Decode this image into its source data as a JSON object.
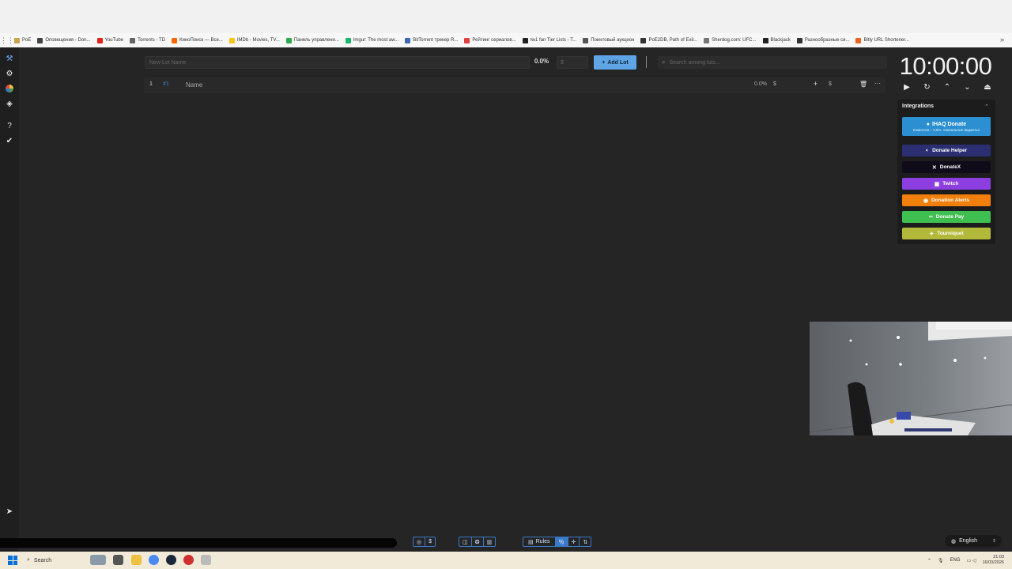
{
  "bookmarks": [
    {
      "label": "PoE",
      "color": "#caa44a"
    },
    {
      "label": "Оповещения - Don...",
      "color": "#444444"
    },
    {
      "label": "YouTube",
      "color": "#e62117"
    },
    {
      "label": "Torrents - TD",
      "color": "#666666"
    },
    {
      "label": "КиноПоиск — Все...",
      "color": "#ff6600"
    },
    {
      "label": "IMDb - Movies, TV...",
      "color": "#f5c518"
    },
    {
      "label": "Панель управлени...",
      "color": "#2fa84f"
    },
    {
      "label": "Imgur: The most aw...",
      "color": "#1bb76e"
    },
    {
      "label": "BitTorrent трекер R...",
      "color": "#3d6ab4"
    },
    {
      "label": "Рейтинг сериалов...",
      "color": "#e04040"
    },
    {
      "label": "№1 fan Tier Lists - T...",
      "color": "#222222"
    },
    {
      "label": "Поинтовый аукцион",
      "color": "#555555"
    },
    {
      "label": "PoE2DB, Path of Exil...",
      "color": "#333333"
    },
    {
      "label": "Sherdog.com: UFC...",
      "color": "#777777"
    },
    {
      "label": "Blackjack",
      "color": "#222222"
    },
    {
      "label": "Разнообразные си...",
      "color": "#333333"
    },
    {
      "label": "Bitly URL Shortener...",
      "color": "#ee6123"
    }
  ],
  "lot_input": {
    "placeholder": "New Lot Name",
    "percent": "0.0%",
    "amount_placeholder": "$"
  },
  "add_lot": {
    "label": "Add Lot"
  },
  "search": {
    "placeholder": "Search among lots..."
  },
  "lots": [
    {
      "index": "1",
      "id": "#1",
      "name": "Name",
      "percent": "0.0%",
      "currency": "$"
    }
  ],
  "timer": {
    "value": "10:00:00"
  },
  "integrations": {
    "title": "Integrations",
    "ihaq_label": "IHAQ Donate",
    "ihaq_sub": "Комиссия – 3,5%. Уникальные виджеты!",
    "donate_helper": "Donate Helper",
    "donatex": "DonateX",
    "twitch": "Twitch",
    "donation_alerts": "Donation Alerts",
    "donate_pay": "Donate Pay",
    "tourniquet": "Tourniquet"
  },
  "integration_colors": {
    "ihaq": "#2b8fd1",
    "donate_helper": "#2b2f72",
    "donatex": "#0f0b18",
    "twitch": "#8d3ee0",
    "donation_alerts": "#f07f0c",
    "donate_pay": "#3fbf4f",
    "tourniquet": "#b2b93a"
  },
  "bottom_toolbar": {
    "rules_label": "Rules"
  },
  "language": {
    "selected": "English"
  },
  "taskbar": {
    "search_label": "Search",
    "lang": "ENG",
    "time": "21:03",
    "date": "16/03/2026"
  }
}
